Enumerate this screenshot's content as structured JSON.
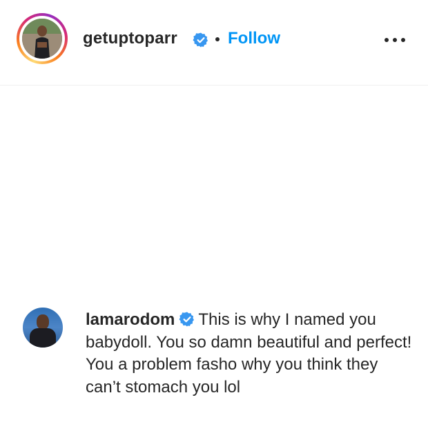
{
  "post": {
    "author": {
      "username": "getuptoparr",
      "verified": true,
      "avatar_icon": "profile-photo"
    },
    "separator": "•",
    "follow_label": "Follow",
    "more_icon": "more-options-icon"
  },
  "comment": {
    "username": "lamarodom",
    "verified": true,
    "text": "This is why I named you babydoll. You so damn beautiful and perfect! You a problem fasho why you think they can’t stomach you lol",
    "avatar_icon": "profile-photo"
  },
  "colors": {
    "link_blue": "#0095f6",
    "verified_blue": "#3897f0",
    "text": "#262626",
    "divider": "#efefef"
  }
}
